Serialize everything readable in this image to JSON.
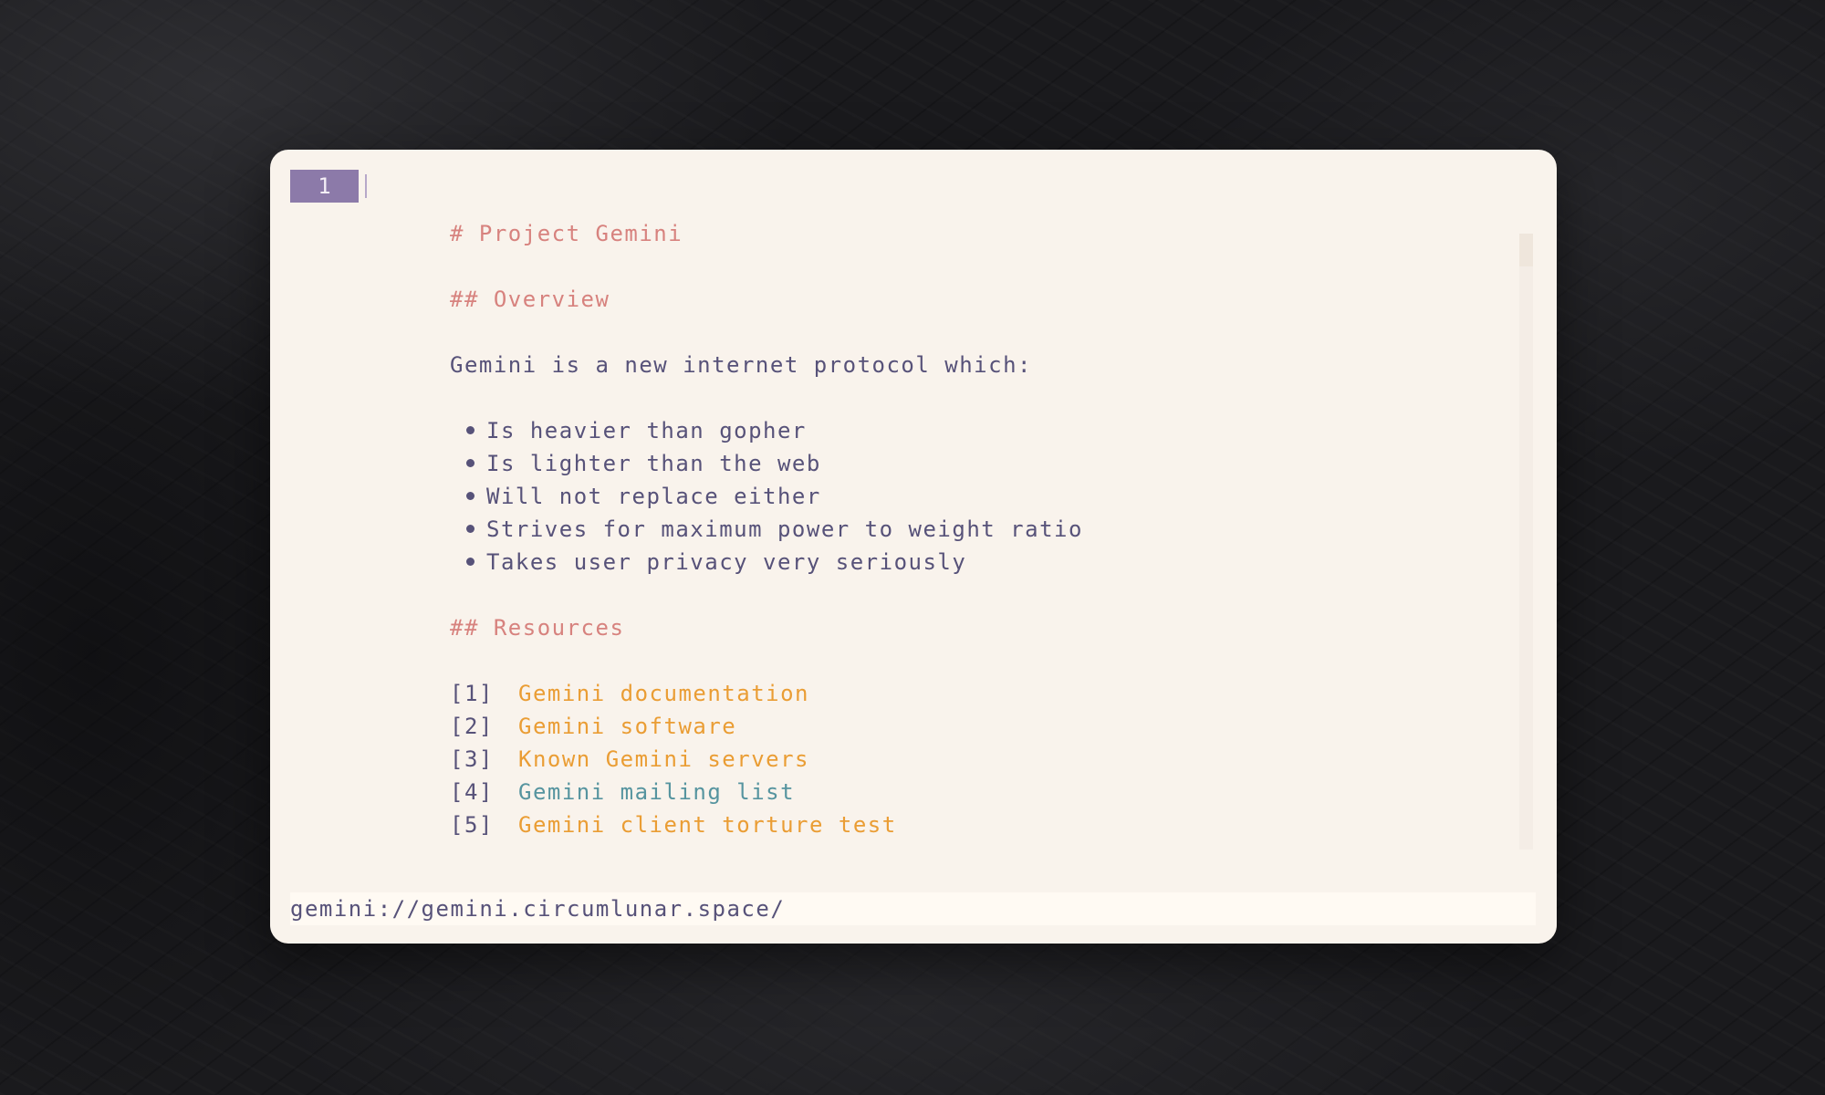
{
  "tabs": [
    {
      "label": "1",
      "active": true
    }
  ],
  "page": {
    "title": "# Project Gemini",
    "overview_heading": "## Overview",
    "intro": "Gemini is a new internet protocol which:",
    "bullets": [
      "Is heavier than gopher",
      "Is lighter than the web",
      "Will not replace either",
      "Strives for maximum power to weight ratio",
      "Takes user privacy very seriously"
    ],
    "resources_heading": "## Resources",
    "links": [
      {
        "index": "[1]",
        "text": "Gemini documentation"
      },
      {
        "index": "[2]",
        "text": "Gemini software"
      },
      {
        "index": "[3]",
        "text": "Known Gemini servers"
      },
      {
        "index": "[4]",
        "text": "Gemini mailing list"
      },
      {
        "index": "[5]",
        "text": "Gemini client torture test"
      }
    ]
  },
  "status": {
    "url": "gemini://gemini.circumlunar.space/"
  },
  "colors": {
    "heading": "#d7827e",
    "text": "#575279",
    "link": "#ea9d34",
    "link_alt": "#56949f",
    "tab_active": "#8c7aa9",
    "window_bg": "#f9f3ec"
  }
}
